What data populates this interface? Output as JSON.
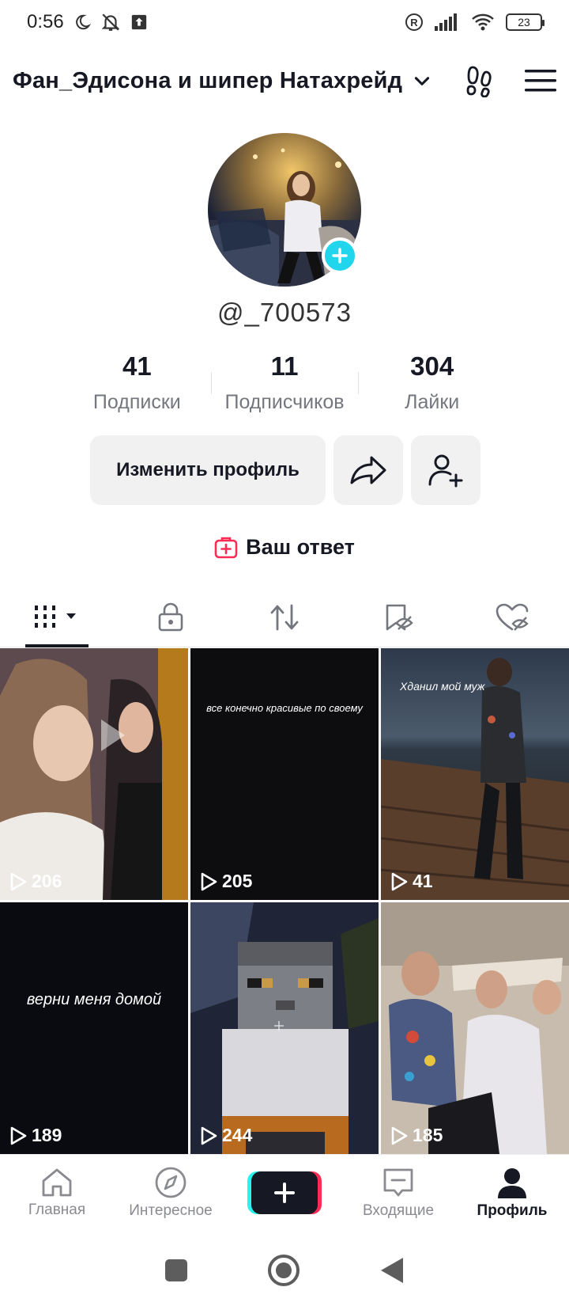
{
  "status": {
    "time": "0:56",
    "battery": "23"
  },
  "header": {
    "title": "Фан_Эдисона и шипер Натахрейд"
  },
  "profile": {
    "username": "@_700573"
  },
  "stats": [
    {
      "value": "41",
      "label": "Подписки"
    },
    {
      "value": "11",
      "label": "Подписчиков"
    },
    {
      "value": "304",
      "label": "Лайки"
    }
  ],
  "actions": {
    "edit_label": "Изменить профиль"
  },
  "answer": {
    "label": "Ваш ответ"
  },
  "videos": [
    {
      "caption": "",
      "views": "206"
    },
    {
      "caption": "все конечно красивые по своему",
      "views": "205"
    },
    {
      "caption": "Хданил мой муж",
      "views": "41"
    },
    {
      "caption": "верни меня домой",
      "views": "189"
    },
    {
      "caption": "",
      "views": "244"
    },
    {
      "caption": "",
      "views": "185"
    }
  ],
  "nav": {
    "home": "Главная",
    "discover": "Интересное",
    "inbox": "Входящие",
    "profile": "Профиль"
  },
  "colors": {
    "accent_cyan": "#20d5ec",
    "accent_pink": "#fe2c55",
    "text": "#161823"
  }
}
